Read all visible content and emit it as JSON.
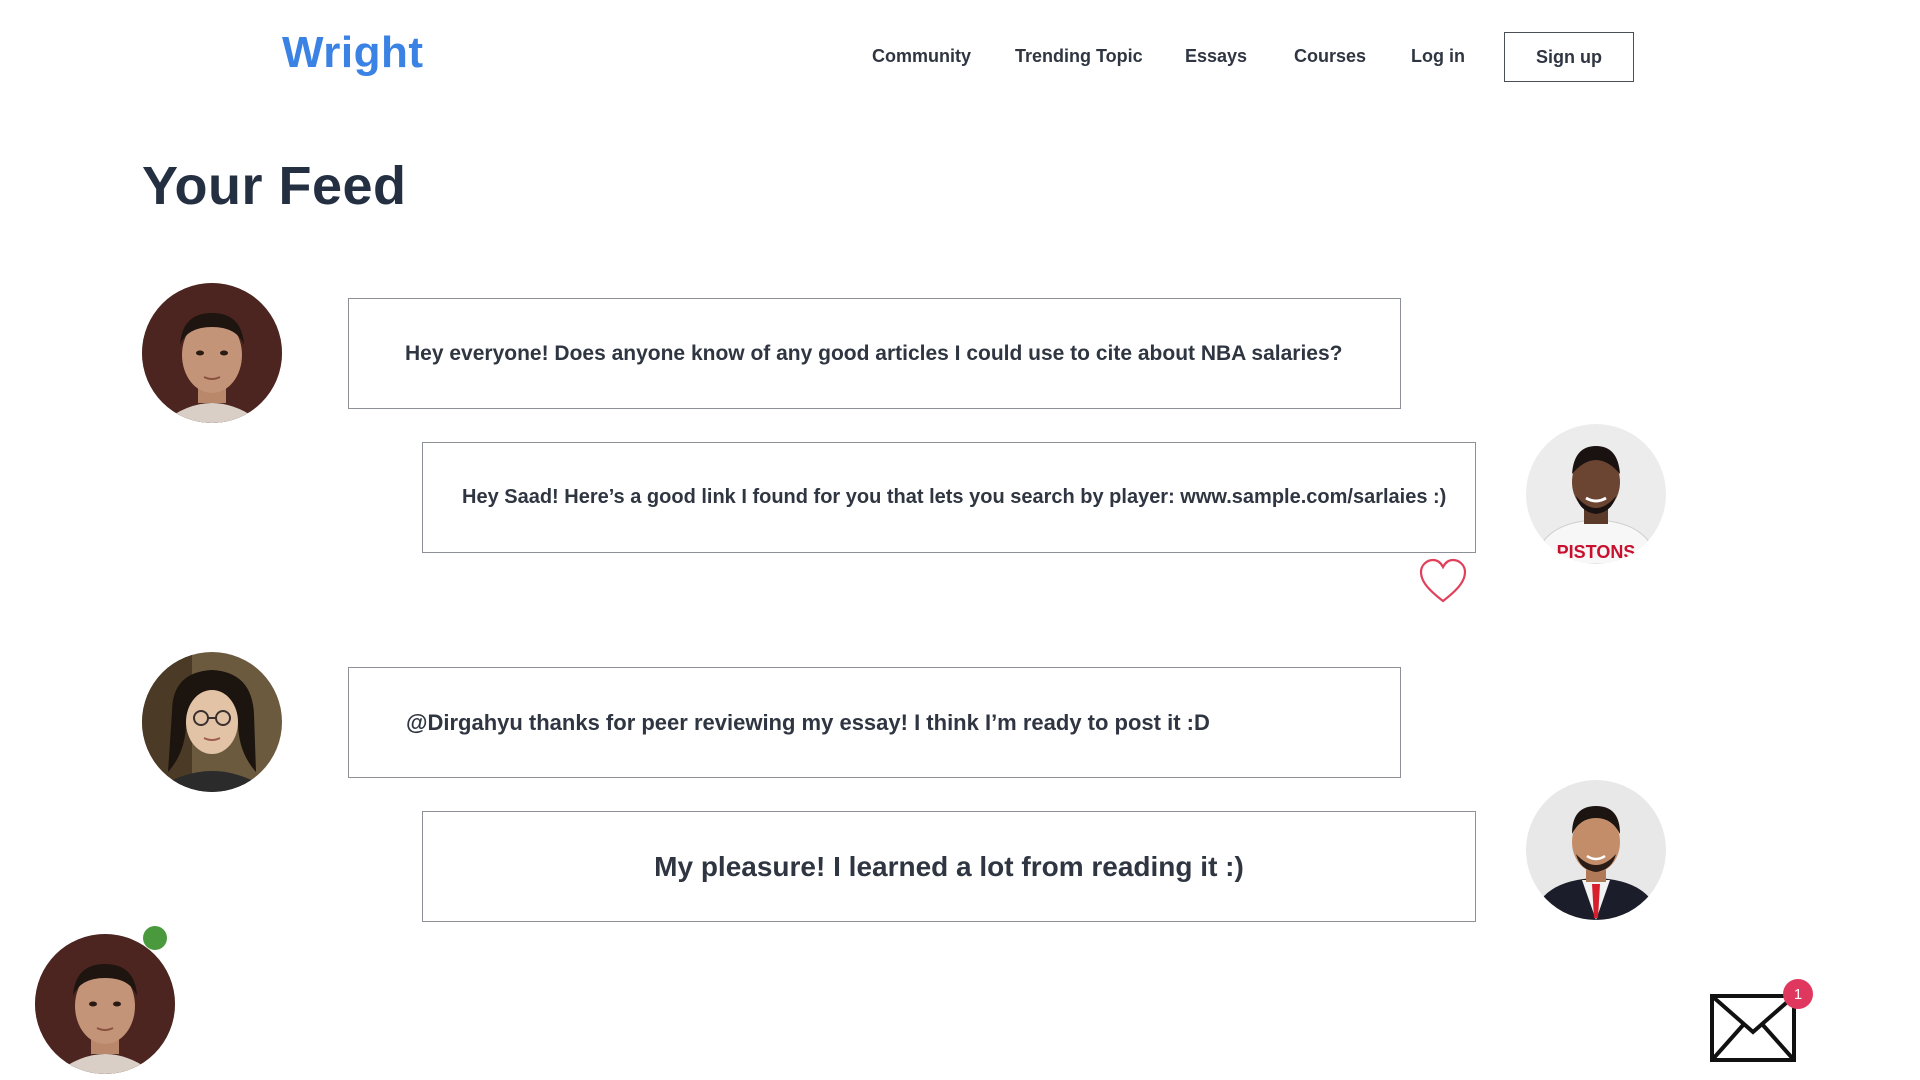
{
  "app": {
    "logo": "Wright",
    "accent_color": "#3a83e4"
  },
  "nav": {
    "items": [
      {
        "label": "Community"
      },
      {
        "label": "Trending Topic"
      },
      {
        "label": "Essays"
      },
      {
        "label": "Courses"
      },
      {
        "label": "Log in"
      }
    ],
    "signup_label": "Sign up"
  },
  "feed": {
    "title": "Your Feed",
    "posts": [
      {
        "text": "Hey everyone! Does anyone know of any good articles I could use to cite about NBA salaries?",
        "avatar_icon": "user-avatar"
      },
      {
        "text": "Hey Saad! Here’s a good link I found for you that lets you search by player: www.sample.com/sarlaies :)",
        "avatar_icon": "user-avatar",
        "liked_icon": "heart-icon"
      },
      {
        "text": "@Dirgahyu thanks for peer reviewing my essay! I think I’m ready to post it :D",
        "avatar_icon": "user-avatar"
      },
      {
        "text": "My pleasure! I learned a lot from reading it :)",
        "avatar_icon": "user-avatar"
      }
    ]
  },
  "current_user": {
    "status": "online",
    "status_color": "#4a9a3d"
  },
  "messages": {
    "icon": "envelope-icon",
    "unread_count": "1",
    "badge_color": "#e0375f"
  }
}
